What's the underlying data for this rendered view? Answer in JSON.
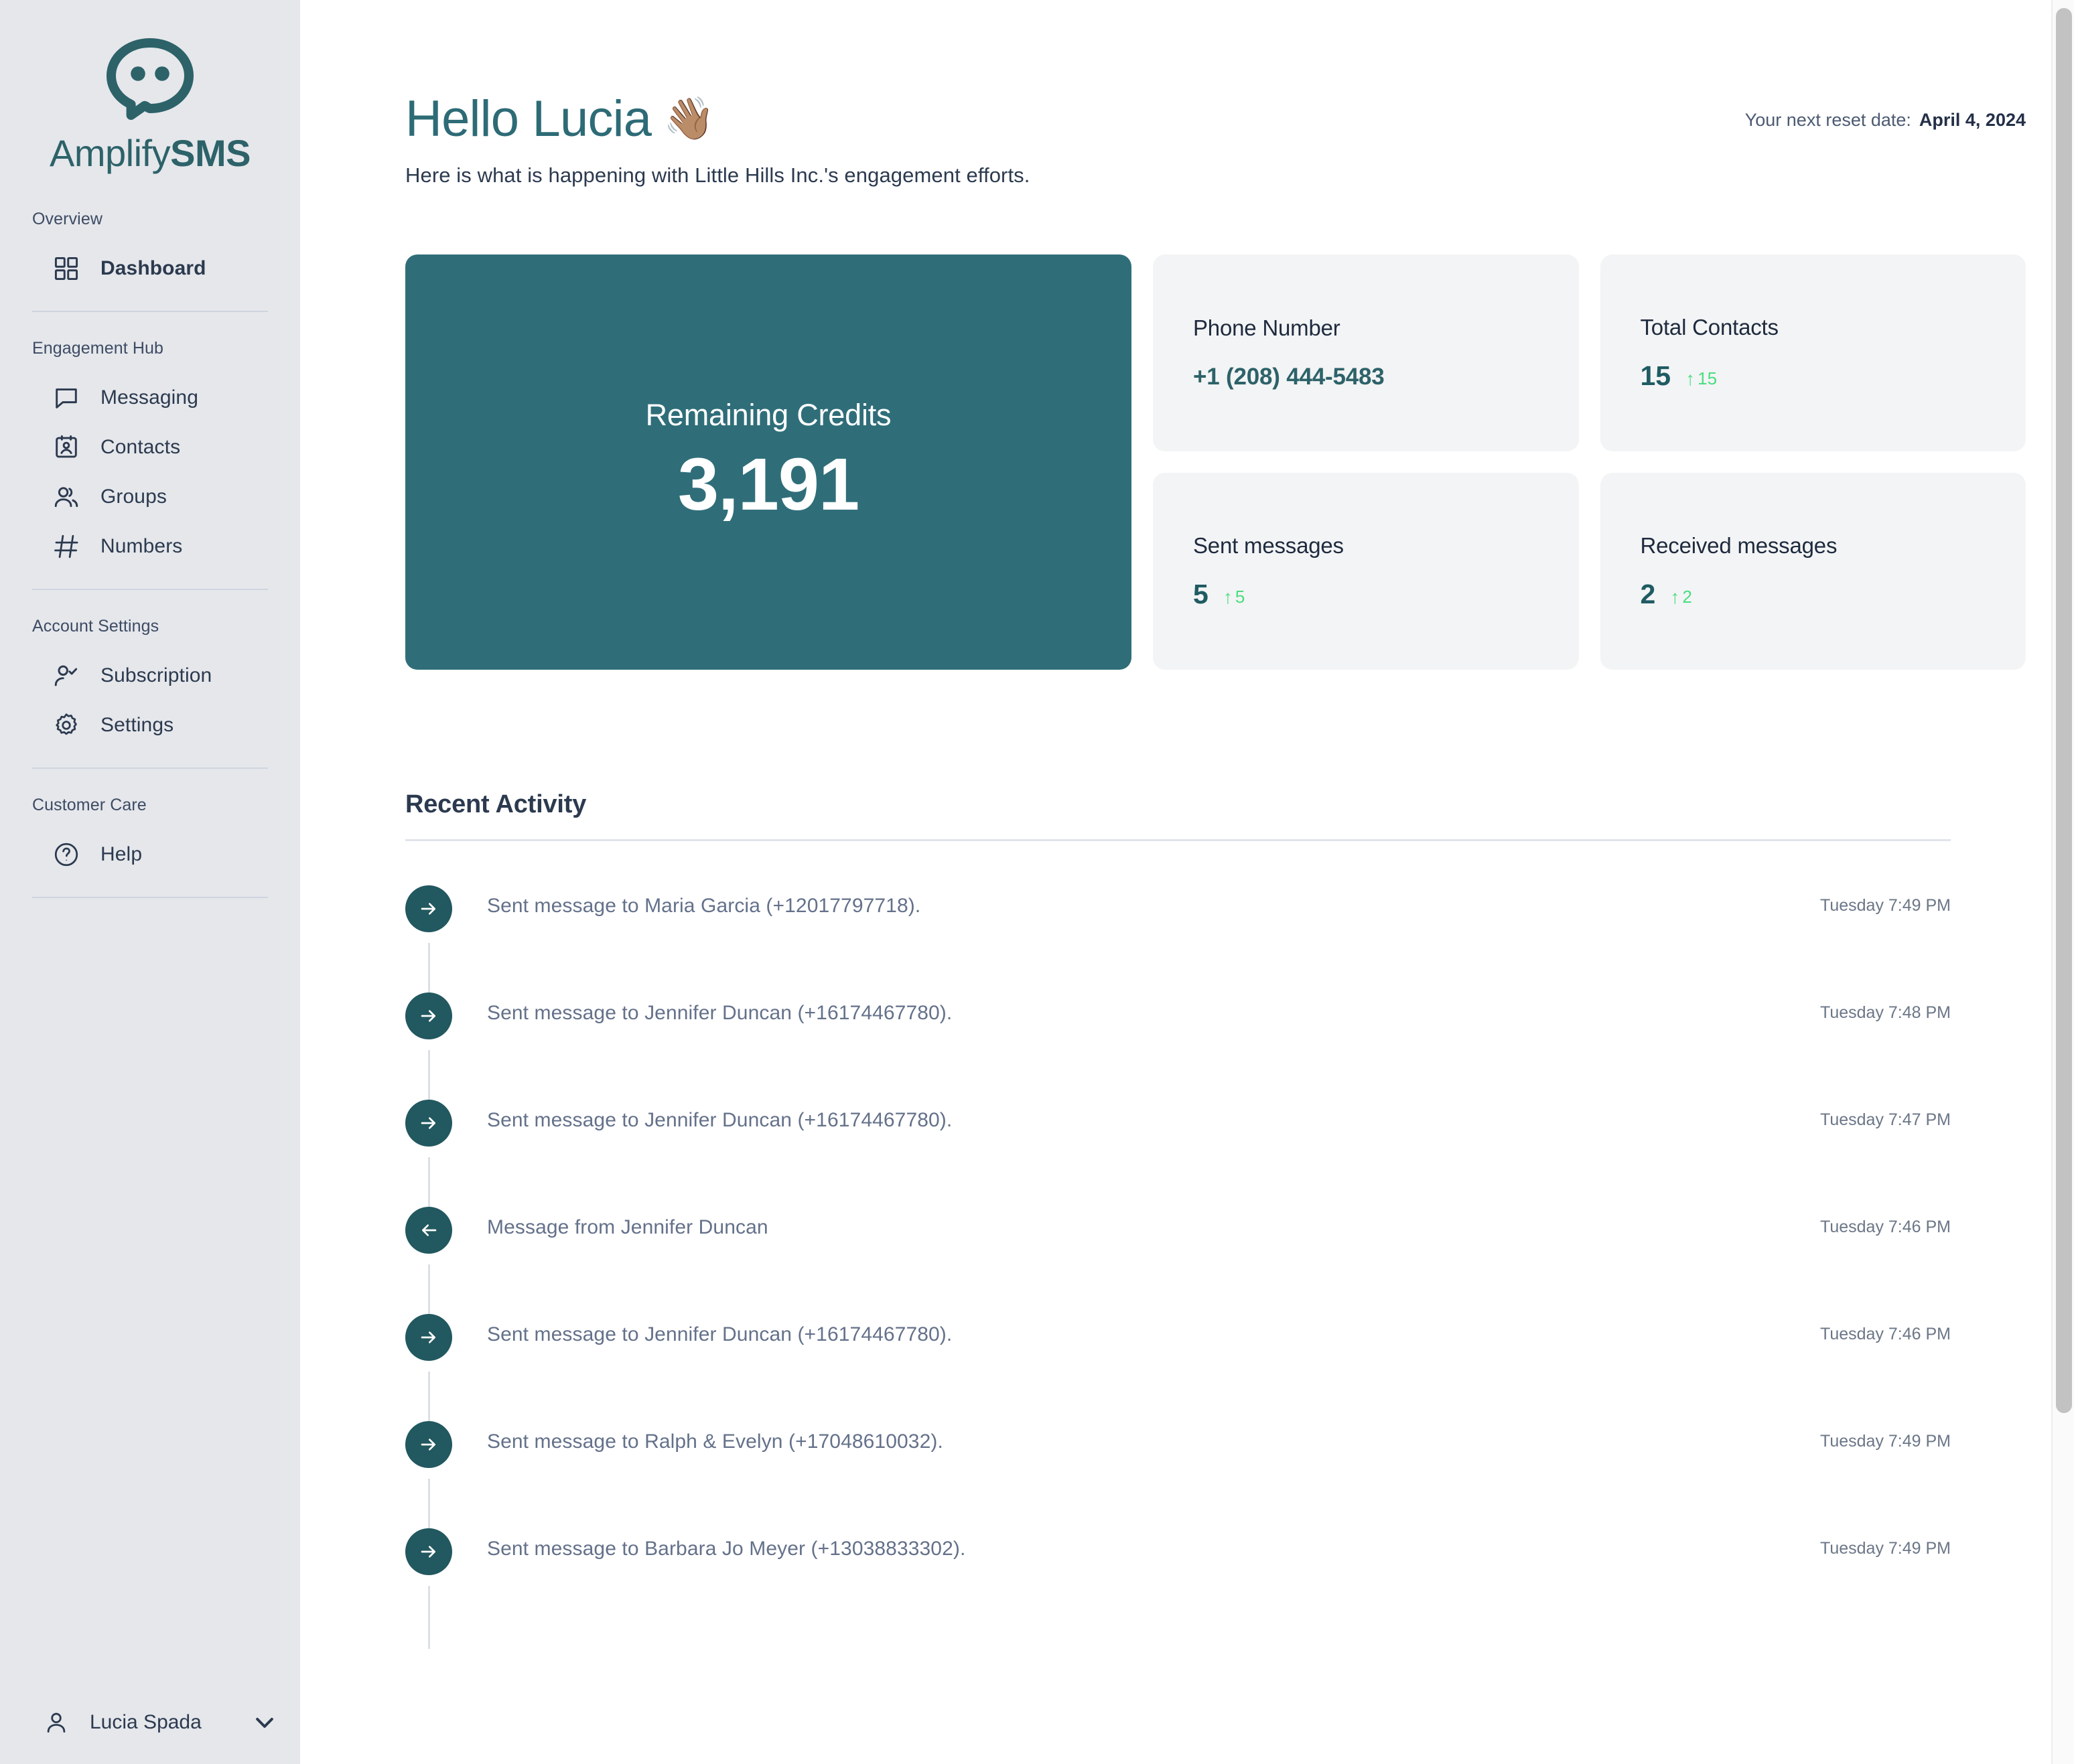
{
  "brand": {
    "name_light": "Amplify",
    "name_bold": "SMS",
    "logo_icon": "speech-bubble-face-icon",
    "teal": "#2D6269",
    "accent_teal": "#2F6E79",
    "green": "#4ADE80"
  },
  "sidebar": {
    "sections": [
      {
        "label": "Overview",
        "items": [
          {
            "label": "Dashboard",
            "icon": "grid-icon",
            "active": true
          }
        ]
      },
      {
        "label": "Engagement Hub",
        "items": [
          {
            "label": "Messaging",
            "icon": "chat-bubble-icon",
            "active": false
          },
          {
            "label": "Contacts",
            "icon": "contact-card-icon",
            "active": false
          },
          {
            "label": "Groups",
            "icon": "users-icon",
            "active": false
          },
          {
            "label": "Numbers",
            "icon": "hash-icon",
            "active": false
          }
        ]
      },
      {
        "label": "Account Settings",
        "items": [
          {
            "label": "Subscription",
            "icon": "user-check-icon",
            "active": false
          },
          {
            "label": "Settings",
            "icon": "gear-icon",
            "active": false
          }
        ]
      },
      {
        "label": "Customer Care",
        "items": [
          {
            "label": "Help",
            "icon": "question-circle-icon",
            "active": false
          }
        ]
      }
    ],
    "user": {
      "name": "Lucia Spada",
      "avatar_icon": "user-icon",
      "chevron_icon": "chevron-down-icon"
    }
  },
  "header": {
    "greeting": "Hello Lucia",
    "wave_emoji": "👋🏽",
    "subtitle": "Here is what is happening with Little Hills Inc.'s engagement efforts.",
    "reset_label": "Your next reset date:",
    "reset_date": "April 4, 2024"
  },
  "stats": {
    "credits": {
      "label": "Remaining Credits",
      "value": "3,191"
    },
    "cards": [
      {
        "title": "Phone Number",
        "value": "+1 (208) 444-5483",
        "kind": "phone"
      },
      {
        "title": "Total Contacts",
        "value": "15",
        "delta": "15",
        "delta_icon": "arrow-up-icon",
        "kind": "metric"
      },
      {
        "title": "Sent messages",
        "value": "5",
        "delta": "5",
        "delta_icon": "arrow-up-icon",
        "kind": "metric"
      },
      {
        "title": "Received messages",
        "value": "2",
        "delta": "2",
        "delta_icon": "arrow-up-icon",
        "kind": "metric"
      }
    ]
  },
  "activity": {
    "title": "Recent Activity",
    "items": [
      {
        "direction": "sent",
        "icon": "arrow-right-icon",
        "text": "Sent message to Maria Garcia (+12017797718).",
        "time": "Tuesday 7:49 PM"
      },
      {
        "direction": "sent",
        "icon": "arrow-right-icon",
        "text": "Sent message to Jennifer Duncan (+16174467780).",
        "time": "Tuesday 7:48 PM"
      },
      {
        "direction": "sent",
        "icon": "arrow-right-icon",
        "text": "Sent message to Jennifer Duncan (+16174467780).",
        "time": "Tuesday 7:47 PM"
      },
      {
        "direction": "received",
        "icon": "arrow-left-icon",
        "text": "Message from Jennifer Duncan",
        "time": "Tuesday 7:46 PM"
      },
      {
        "direction": "sent",
        "icon": "arrow-right-icon",
        "text": "Sent message to Jennifer Duncan (+16174467780).",
        "time": "Tuesday 7:46 PM"
      },
      {
        "direction": "sent",
        "icon": "arrow-right-icon",
        "text": "Sent message to Ralph & Evelyn (+17048610032).",
        "time": "Tuesday 7:49 PM"
      },
      {
        "direction": "sent",
        "icon": "arrow-right-icon",
        "text": "Sent message to Barbara Jo Meyer (+13038833302).",
        "time": "Tuesday 7:49 PM"
      }
    ]
  }
}
